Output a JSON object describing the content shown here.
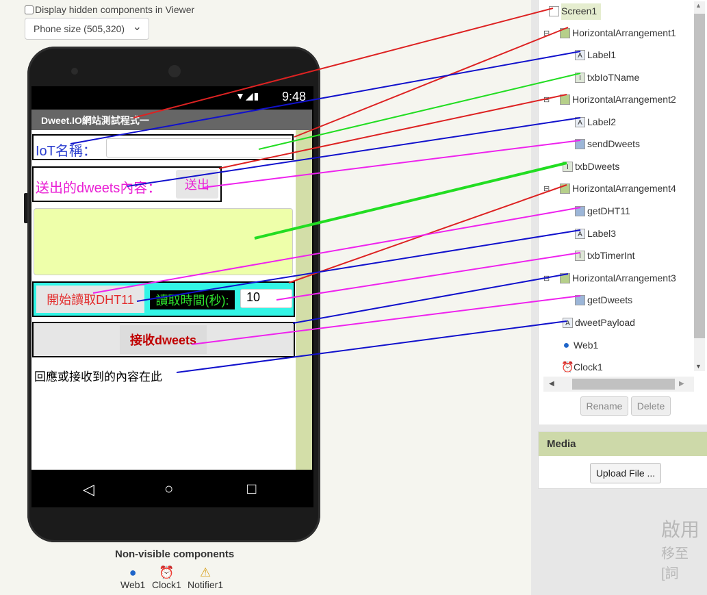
{
  "viewer": {
    "hidden_components_label": "Display hidden components in Viewer",
    "phone_size": "Phone size (505,320)",
    "chevron": "⌄"
  },
  "phone": {
    "status_time": "9:48",
    "status_icons": "▼◢▮",
    "title": "Dweet.IO網站測試程式一",
    "label1": "IoT名稱：",
    "txbIoTName_value": "",
    "label2": "送出的dweets內容：",
    "send_button": "送出",
    "txbDweets_value": "",
    "getDHT11_button": "開始讀取DHT11",
    "label3": "讀取時間(秒):",
    "timer_value": "10",
    "getDweets_button": "接收dweets",
    "dweetPayload": "回應或接收到的內容在此",
    "nav_back": "◁",
    "nav_home": "○",
    "nav_recent": "□"
  },
  "non_visible": {
    "title": "Non-visible components",
    "items": [
      {
        "label": "Web1",
        "icon": "globe-icon",
        "glyph": "●"
      },
      {
        "label": "Clock1",
        "icon": "clock-icon",
        "glyph": "⏰"
      },
      {
        "label": "Notifier1",
        "icon": "warning-icon",
        "glyph": "⚠"
      }
    ]
  },
  "tree": {
    "collapse_glyph": "⊟",
    "items": [
      {
        "label": "Screen1",
        "icon": "screen-icon"
      },
      {
        "label": "HorizontalArrangement1",
        "icon": "arrangement-icon"
      },
      {
        "label": "Label1",
        "icon": "label-icon",
        "glyph": "A"
      },
      {
        "label": "txbIoTName",
        "icon": "textbox-icon",
        "glyph": "I"
      },
      {
        "label": "HorizontalArrangement2",
        "icon": "arrangement-icon"
      },
      {
        "label": "Label2",
        "icon": "label-icon",
        "glyph": "A"
      },
      {
        "label": "sendDweets",
        "icon": "button-icon"
      },
      {
        "label": "txbDweets",
        "icon": "textbox-icon",
        "glyph": "I"
      },
      {
        "label": "HorizontalArrangement4",
        "icon": "arrangement-icon"
      },
      {
        "label": "getDHT11",
        "icon": "button-icon"
      },
      {
        "label": "Label3",
        "icon": "label-icon",
        "glyph": "A"
      },
      {
        "label": "txbTimerInt",
        "icon": "textbox-icon",
        "glyph": "I"
      },
      {
        "label": "HorizontalArrangement3",
        "icon": "arrangement-icon"
      },
      {
        "label": "getDweets",
        "icon": "button-icon"
      },
      {
        "label": "dweetPayload",
        "icon": "label-icon",
        "glyph": "A"
      },
      {
        "label": "Web1",
        "icon": "globe-icon",
        "glyph": "●"
      },
      {
        "label": "Clock1",
        "icon": "clock-icon",
        "glyph": "⏰"
      }
    ],
    "rename_button": "Rename",
    "delete_button": "Delete",
    "scroll_left": "◀",
    "scroll_right": "▶",
    "scroll_up": "▲",
    "scroll_down": "▼"
  },
  "media": {
    "title": "Media",
    "upload_button": "Upload File ..."
  },
  "watermark": {
    "line1": "啟用",
    "line2": "移至 [詞"
  },
  "colors": {
    "arrangement_link": "#dd2222",
    "label_link": "#1111cc",
    "textbox_link": "#22dd22",
    "button_link": "#ee22ee"
  }
}
